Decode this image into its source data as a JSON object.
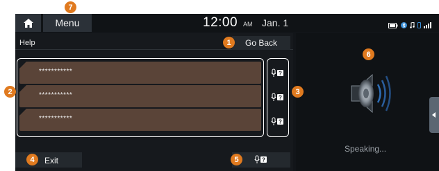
{
  "header": {
    "menu_label": "Menu",
    "time": "12:00",
    "ampm": "AM",
    "date": "Jan. 1"
  },
  "help": {
    "title": "Help",
    "go_back_label": "Go Back"
  },
  "commands": [
    {
      "text": "***********"
    },
    {
      "text": "***********"
    },
    {
      "text": "***********"
    }
  ],
  "footer": {
    "exit_label": "Exit"
  },
  "voice_panel": {
    "status": "Speaking..."
  },
  "callouts": [
    "1",
    "2",
    "3",
    "4",
    "5",
    "6",
    "7"
  ],
  "colors": {
    "callout": "#e07a1f",
    "list_row": "#5a4438",
    "background": "#121519"
  },
  "icons": {
    "home": "home-icon",
    "voice_help": "voice-help-icon",
    "speaker": "speaker-icon"
  }
}
